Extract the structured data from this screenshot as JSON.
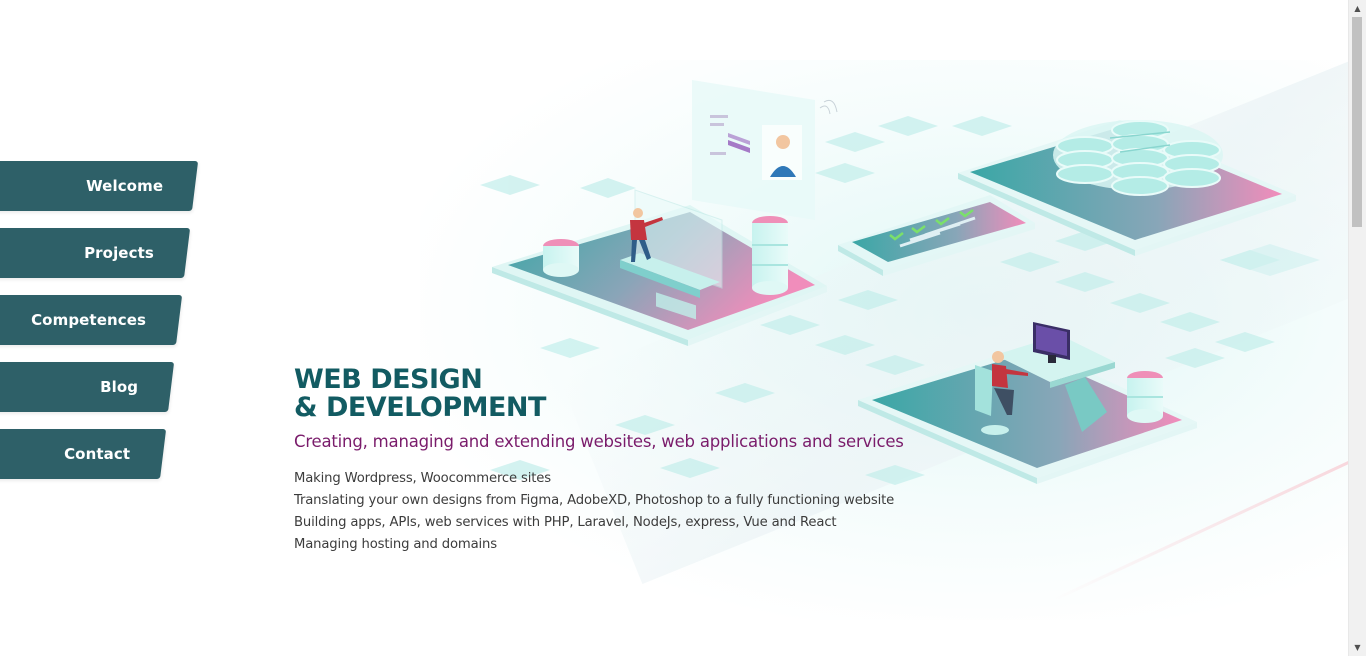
{
  "nav": {
    "items": [
      {
        "label": "Welcome"
      },
      {
        "label": "Projects"
      },
      {
        "label": "Competences"
      },
      {
        "label": "Blog"
      },
      {
        "label": "Contact"
      }
    ]
  },
  "hero": {
    "title_line1": "WEB DESIGN",
    "title_line2": "& DEVELOPMENT",
    "subtitle": "Creating, managing and extending websites, web applications and services",
    "services": [
      "Making Wordpress, Woocommerce sites",
      "Translating your own designs from Figma, AdobeXD, Photoshop to a fully functioning website",
      "Building apps, APIs, web services with PHP, Laravel, NodeJs, express, Vue and React",
      "Managing hosting and domains"
    ]
  },
  "colors": {
    "nav_bg": "#2e6068",
    "title": "#125b62",
    "subtitle": "#7a1c6b",
    "teal_light": "#bfeeea",
    "pink": "#f38fb8"
  },
  "icons": {
    "scroll_up": "triangle-up-icon",
    "scroll_down": "triangle-down-icon"
  }
}
